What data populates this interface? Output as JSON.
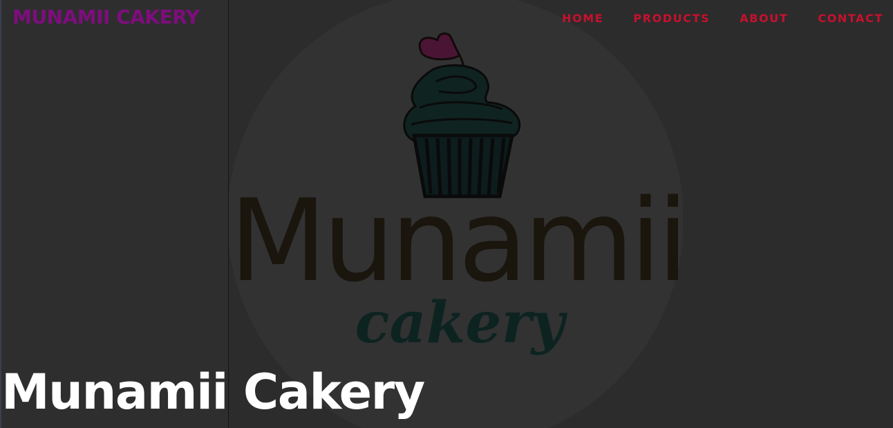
{
  "header": {
    "brand": "MUNAMII CAKERY",
    "nav": [
      {
        "label": "HOME"
      },
      {
        "label": "PRODUCTS"
      },
      {
        "label": "ABOUT"
      },
      {
        "label": "CONTACT"
      }
    ]
  },
  "hero": {
    "logo_word_main": "Munamii",
    "logo_word_sub": "cakery",
    "title": "Munamii Cakery"
  },
  "colors": {
    "brand": "#7e0d7e",
    "nav_link": "#c8102e",
    "heart": "#4a1535",
    "frosting": "#0f2320",
    "logo_text": "#1a150d",
    "logo_subtext": "#0d2320",
    "hero_title": "#ffffff",
    "background": "#2c2c2c"
  },
  "icons": {
    "logo": "cupcake-with-heart-logo"
  }
}
